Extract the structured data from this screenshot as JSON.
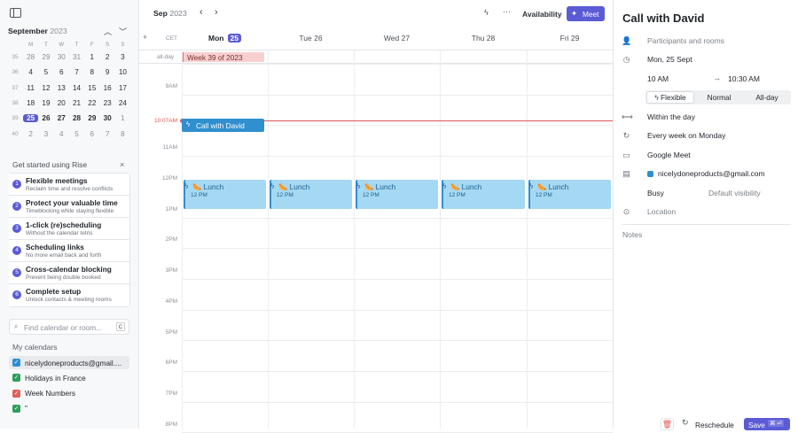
{
  "sidebar": {
    "month": "September",
    "year": "2023",
    "weekday_headers": [
      "M",
      "T",
      "W",
      "T",
      "F",
      "S",
      "S"
    ],
    "weeks": [
      {
        "wk": "35",
        "days": [
          "28",
          "29",
          "30",
          "31",
          "1",
          "2",
          "3"
        ]
      },
      {
        "wk": "36",
        "days": [
          "4",
          "5",
          "6",
          "7",
          "8",
          "9",
          "10"
        ]
      },
      {
        "wk": "37",
        "days": [
          "11",
          "12",
          "13",
          "14",
          "15",
          "16",
          "17"
        ]
      },
      {
        "wk": "38",
        "days": [
          "18",
          "19",
          "20",
          "21",
          "22",
          "23",
          "24"
        ]
      },
      {
        "wk": "39",
        "days": [
          "25",
          "26",
          "27",
          "28",
          "29",
          "30",
          "1"
        ]
      },
      {
        "wk": "40",
        "days": [
          "2",
          "3",
          "4",
          "5",
          "6",
          "7",
          "8"
        ]
      }
    ],
    "get_started_title": "Get started using Rise",
    "steps": [
      {
        "n": "1",
        "title": "Flexible meetings",
        "sub": "Reclaim time and resolve conflicts"
      },
      {
        "n": "2",
        "title": "Protect your valuable time",
        "sub": "Timeblocking while staying flexible"
      },
      {
        "n": "3",
        "title": "1-click (re)scheduling",
        "sub": "Without the calendar tetris"
      },
      {
        "n": "4",
        "title": "Scheduling links",
        "sub": "No more email back and forth"
      },
      {
        "n": "5",
        "title": "Cross-calendar blocking",
        "sub": "Prevent being double booked"
      },
      {
        "n": "6",
        "title": "Complete setup",
        "sub": "Unlock contacts & meeting rooms"
      }
    ],
    "search_placeholder": "Find calendar or room...",
    "search_shortcut": "C",
    "my_calendars_label": "My calendars",
    "calendars": [
      {
        "name": "nicelydoneproducts@gmail....",
        "color": "#2f8fcf"
      },
      {
        "name": "Holidays in France",
        "color": "#2e9e5b"
      },
      {
        "name": "Week Numbers",
        "color": "#e0605a"
      },
      {
        "name": "\"",
        "color": "#2e9e5b"
      }
    ]
  },
  "toolbar": {
    "month": "Sep",
    "year": "2023",
    "availability_label": "Availability",
    "meet_label": "Meet",
    "timezone": "CET",
    "allday_label": "all-day"
  },
  "days": [
    {
      "label": "Mon",
      "num": "25",
      "today": true
    },
    {
      "label": "Tue 26"
    },
    {
      "label": "Wed 27"
    },
    {
      "label": "Thu 28"
    },
    {
      "label": "Fri 29"
    }
  ],
  "time_labels": [
    "9AM",
    "10:07AM",
    "11AM",
    "12PM",
    "1PM",
    "2PM",
    "3PM",
    "4PM",
    "5PM",
    "6PM",
    "7PM",
    "8PM"
  ],
  "allday_event": "Week 39 of 2023",
  "events": {
    "call": {
      "title": "Call with David"
    },
    "lunch": {
      "title": "🌭 Lunch",
      "time": "12 PM"
    }
  },
  "panel": {
    "title": "Call with David",
    "participants": "Participants and rooms",
    "date": "Mon, 25 Sept",
    "start_time": "10 AM",
    "end_time": "10:30 AM",
    "modes": [
      "Flexible",
      "Normal",
      "All-day"
    ],
    "within": "Within the day",
    "recurrence": "Every week on Monday",
    "conference": "Google Meet",
    "calendar": "nicelydoneproducts@gmail.com",
    "status": "Busy",
    "visibility": "Default visibility",
    "location": "Location",
    "notes": "Notes",
    "reschedule_label": "Reschedule",
    "save_label": "Save"
  },
  "colors": {
    "accent": "#5b5bd6",
    "event": "#a5d8f2",
    "now_line": "#e05656"
  }
}
